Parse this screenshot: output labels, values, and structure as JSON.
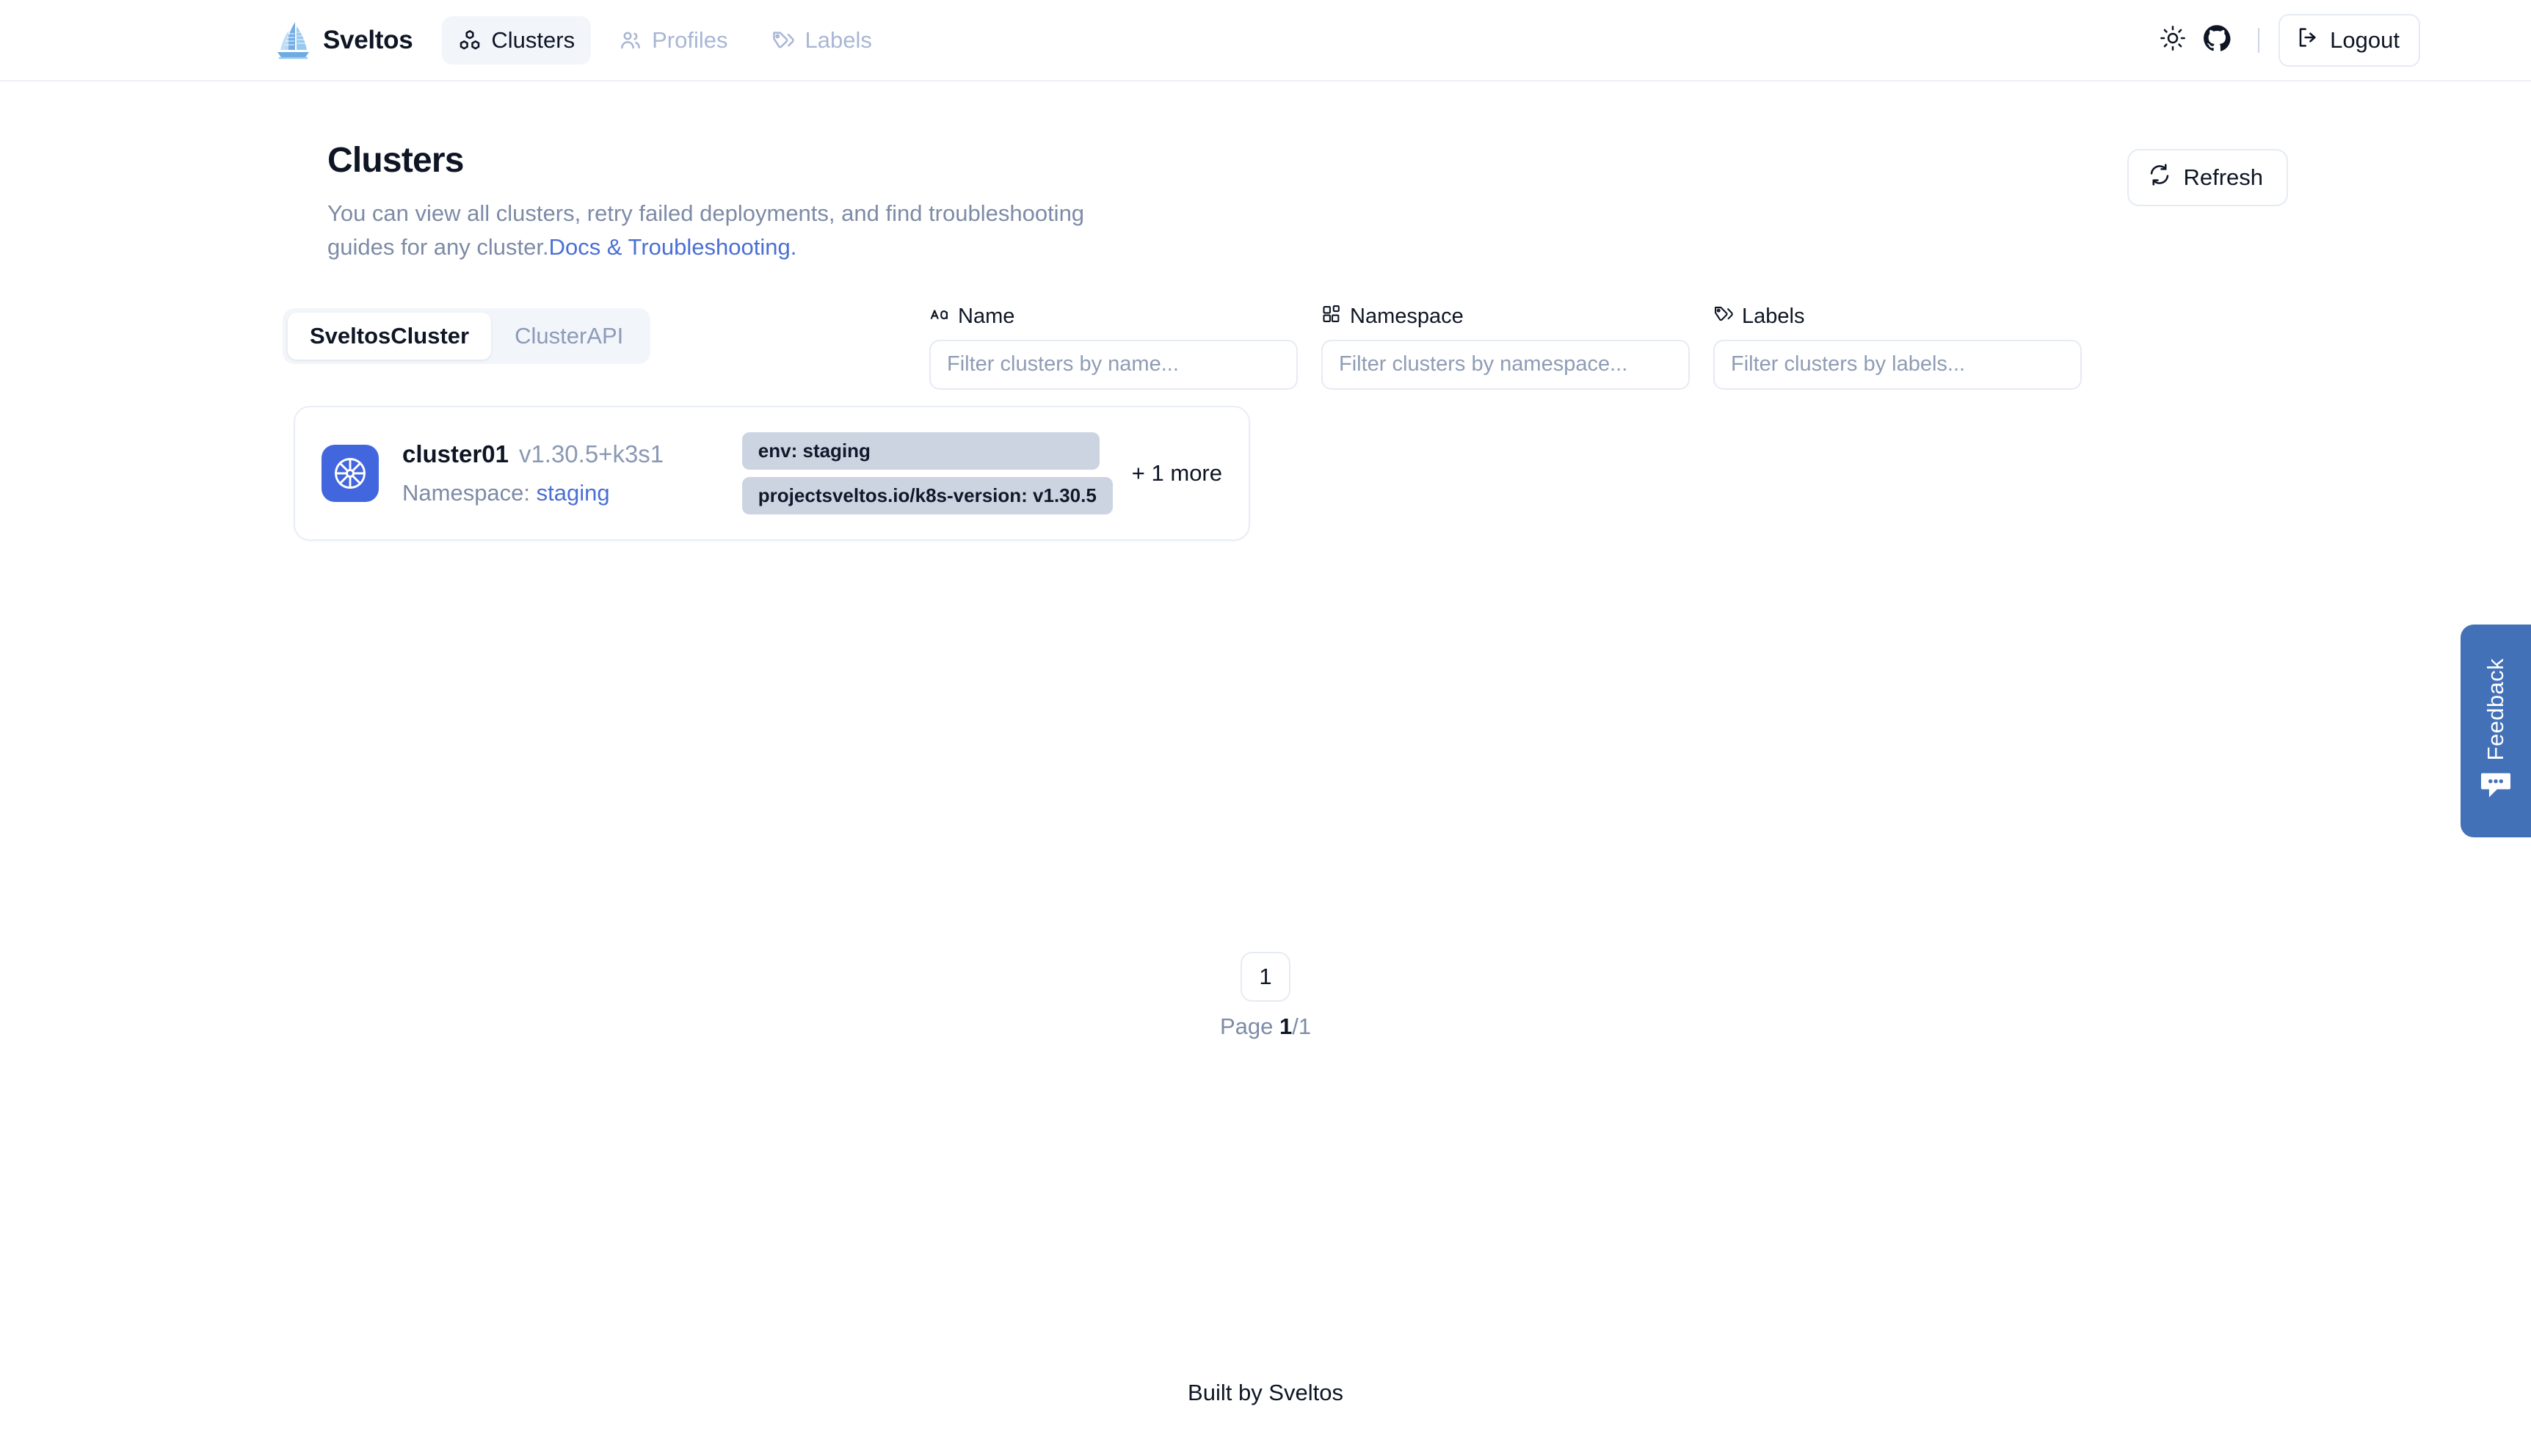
{
  "navbar": {
    "brand": "Sveltos",
    "logo_icon": "sailboat-logo",
    "items": [
      {
        "label": "Clusters",
        "icon": "boxes-icon",
        "active": true
      },
      {
        "label": "Profiles",
        "icon": "users-icon",
        "active": false
      },
      {
        "label": "Labels",
        "icon": "tags-icon",
        "active": false
      }
    ],
    "theme_toggle_icon": "sun-icon",
    "github_icon": "github-icon",
    "divider": "|",
    "logout_label": "Logout",
    "logout_icon": "logout-icon"
  },
  "header": {
    "title": "Clusters",
    "description_before": "You can view all clusters, retry failed deployments, and find troubleshooting guides for any cluster.",
    "description_link": "Docs & Troubleshooting.",
    "refresh_label": "Refresh",
    "refresh_icon": "refresh-icon"
  },
  "tabs": [
    {
      "label": "SveltosCluster",
      "active": true
    },
    {
      "label": "ClusterAPI",
      "active": false
    }
  ],
  "filters": [
    {
      "label": "Name",
      "icon": "case-sensitive-icon",
      "placeholder": "Filter clusters by name...",
      "value": ""
    },
    {
      "label": "Namespace",
      "icon": "layout-blocks-icon",
      "placeholder": "Filter clusters by namespace...",
      "value": ""
    },
    {
      "label": "Labels",
      "icon": "tags-icon",
      "placeholder": "Filter clusters by labels...",
      "value": ""
    }
  ],
  "clusters": [
    {
      "icon": "kubernetes-icon",
      "name": "cluster01",
      "version": "v1.30.5+k3s1",
      "namespace_label": "Namespace:",
      "namespace_value": "staging",
      "labels": [
        "env: staging",
        "projectsveltos.io/k8s-version: v1.30.5"
      ],
      "more_labels": "+ 1 more"
    }
  ],
  "pagination": {
    "current_page": "1",
    "info_prefix": "Page ",
    "info_current": "1",
    "info_suffix": "/1"
  },
  "footer": {
    "text": "Built by Sveltos"
  },
  "feedback": {
    "label": "Feedback",
    "icon": "chat-bubble-icon"
  },
  "colors": {
    "accent_blue": "#4a6fd4",
    "k8s_badge": "#4266dd",
    "feedback_blue": "#4371b8",
    "chip_bg": "#ccd4e2",
    "text_dark": "#0e1524",
    "text_muted": "#7d8ba6",
    "border": "#e6ebf3",
    "tabgroup_bg": "#f2f5fa"
  }
}
